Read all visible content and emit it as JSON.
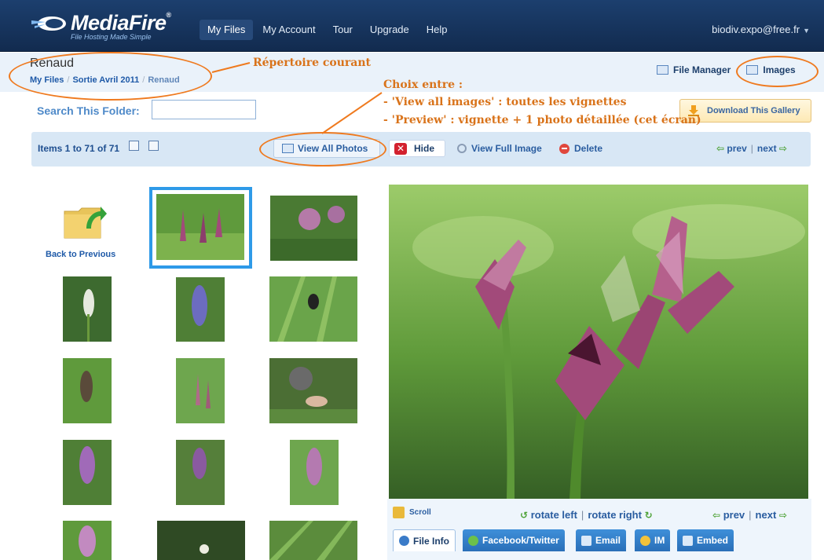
{
  "nav": {
    "logo_name": "MediaFire",
    "logo_reg": "®",
    "logo_tagline": "File Hosting Made Simple",
    "items": [
      "My Files",
      "My Account",
      "Tour",
      "Upgrade",
      "Help"
    ],
    "active": "My Files",
    "user": "biodiv.expo@free.fr",
    "user_caret": "▼"
  },
  "header": {
    "folder_name": "Renaud",
    "breadcrumb": [
      "My Files",
      "Sortie Avril 2011",
      "Renaud"
    ],
    "breadcrumb_sep": "/",
    "file_manager": "File Manager",
    "images": "Images"
  },
  "annotations": {
    "current_dir": "Répertoire courant",
    "choice_title": "Choix entre :",
    "choice_view_all": "- 'View all images' : toutes les vignettes",
    "choice_preview": "- 'Preview' : vignette + 1 photo détaillée (cet écran)",
    "color": "#ef7a1f"
  },
  "search": {
    "label": "Search This Folder:",
    "value": ""
  },
  "download": {
    "label": "Download This Gallery"
  },
  "toolbar": {
    "items_count": "Items 1 to 71 of 71",
    "view_all": "View All Photos",
    "hide": "Hide",
    "hide_glyph": "✕",
    "view_full": "View Full Image",
    "delete": "Delete",
    "prev": "prev",
    "next": "next",
    "pipe": "|",
    "prev_arrow": "⇦",
    "next_arrow": "⇨"
  },
  "grid": {
    "back_label": "Back to Previous"
  },
  "preview": {
    "scroll": "Scroll",
    "rotate_left": "rotate left",
    "rotate_right": "rotate right",
    "pipe": "|",
    "rotate_left_glyph": "↺",
    "rotate_right_glyph": "↻",
    "prev": "prev",
    "next": "next",
    "prev_arrow": "⇦",
    "next_arrow": "⇨",
    "tabs": [
      "File Info",
      "Facebook/Twitter",
      "Email",
      "IM",
      "Embed"
    ]
  },
  "colors": {
    "nav_bg": "#1c3f6e",
    "link": "#2a5da0",
    "selection": "#2e9ae8",
    "delete": "#e0473d",
    "hide": "#d3212e"
  },
  "icons": [
    "folder-back-icon",
    "file-manager-icon",
    "images-icon",
    "download-icon",
    "hide-x-icon",
    "magnifier-icon",
    "delete-icon",
    "scroll-icon",
    "info-icon"
  ]
}
